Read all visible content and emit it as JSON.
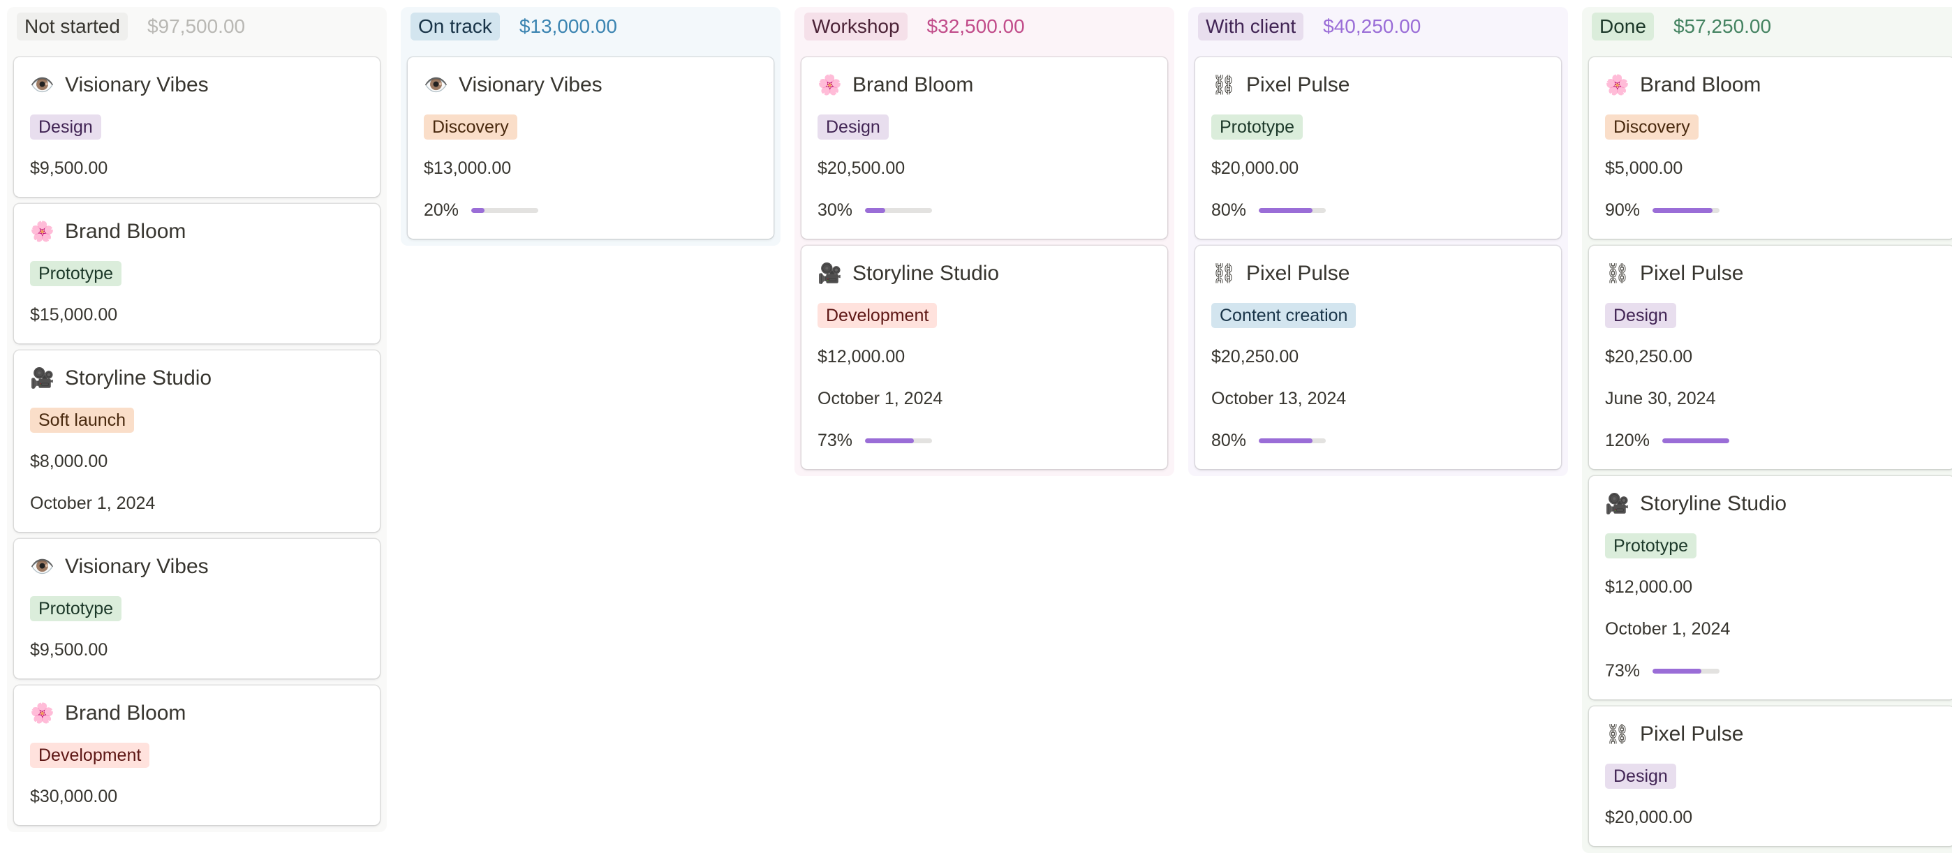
{
  "colors": {
    "accent_progress": "#9a6dd7",
    "tag_design": "#e8deee",
    "tag_prototype": "#dbeddb",
    "tag_discovery": "#fadec9",
    "tag_soft_launch": "#fadec9",
    "tag_development": "#ffe2dd",
    "tag_content_creation": "#d3e5ef"
  },
  "columns": [
    {
      "name": "Not started",
      "total": "$97,500.00",
      "bg": "#f9f9f8",
      "pill_bg": "#efefed",
      "pill_color": "#37352f",
      "total_color": "#b9b8b4",
      "cards": [
        {
          "icon": "eye-icon",
          "glyph": "👁️",
          "title": "Visionary Vibes",
          "tag": "Design",
          "tag_bg": "#e8deee",
          "tag_color": "#412454",
          "amount": "$9,500.00"
        },
        {
          "icon": "flower-icon",
          "glyph": "🌸",
          "title": "Brand Bloom",
          "tag": "Prototype",
          "tag_bg": "#dbeddb",
          "tag_color": "#1c3829",
          "amount": "$15,000.00"
        },
        {
          "icon": "film-camera-icon",
          "glyph": "🎥",
          "title": "Storyline Studio",
          "tag": "Soft launch",
          "tag_bg": "#fadec9",
          "tag_color": "#49290e",
          "amount": "$8,000.00",
          "date": "October 1, 2024"
        },
        {
          "icon": "eye-icon",
          "glyph": "👁️",
          "title": "Visionary Vibes",
          "tag": "Prototype",
          "tag_bg": "#dbeddb",
          "tag_color": "#1c3829",
          "amount": "$9,500.00"
        },
        {
          "icon": "flower-icon",
          "glyph": "🌸",
          "title": "Brand Bloom",
          "tag": "Development",
          "tag_bg": "#ffe2dd",
          "tag_color": "#5d1715",
          "amount": "$30,000.00"
        }
      ]
    },
    {
      "name": "On track",
      "total": "$13,000.00",
      "bg": "#f3f8fb",
      "pill_bg": "#d3e5ef",
      "pill_color": "#183347",
      "total_color": "#3b84b1",
      "cards": [
        {
          "icon": "eye-icon",
          "glyph": "👁️",
          "title": "Visionary Vibes",
          "tag": "Discovery",
          "tag_bg": "#fadec9",
          "tag_color": "#49290e",
          "amount": "$13,000.00",
          "progress_label": "20%",
          "progress": 0.2
        }
      ]
    },
    {
      "name": "Workshop",
      "total": "$32,500.00",
      "bg": "#fcf4f8",
      "pill_bg": "#f5e0e9",
      "pill_color": "#4c2337",
      "total_color": "#c14c8a",
      "cards": [
        {
          "icon": "flower-icon",
          "glyph": "🌸",
          "title": "Brand Bloom",
          "tag": "Design",
          "tag_bg": "#e8deee",
          "tag_color": "#412454",
          "amount": "$20,500.00",
          "progress_label": "30%",
          "progress": 0.3
        },
        {
          "icon": "film-camera-icon",
          "glyph": "🎥",
          "title": "Storyline Studio",
          "tag": "Development",
          "tag_bg": "#ffe2dd",
          "tag_color": "#5d1715",
          "amount": "$12,000.00",
          "date": "October 1, 2024",
          "progress_label": "73%",
          "progress": 0.73
        }
      ]
    },
    {
      "name": "With client",
      "total": "$40,250.00",
      "bg": "#f8f5fc",
      "pill_bg": "#e8deee",
      "pill_color": "#412454",
      "total_color": "#9a6dd7",
      "cards": [
        {
          "icon": "chain-link-icon",
          "glyph": "⛓",
          "title": "Pixel Pulse",
          "tag": "Prototype",
          "tag_bg": "#dbeddb",
          "tag_color": "#1c3829",
          "amount": "$20,000.00",
          "progress_label": "80%",
          "progress": 0.8
        },
        {
          "icon": "chain-link-icon",
          "glyph": "⛓",
          "title": "Pixel Pulse",
          "tag": "Content creation",
          "tag_bg": "#d3e5ef",
          "tag_color": "#183347",
          "amount": "$20,250.00",
          "date": "October 13, 2024",
          "progress_label": "80%",
          "progress": 0.8
        }
      ]
    },
    {
      "name": "Done",
      "total": "$57,250.00",
      "bg": "#f4f8f3",
      "pill_bg": "#dbeddb",
      "pill_color": "#1c3829",
      "total_color": "#448361",
      "cards": [
        {
          "icon": "flower-icon",
          "glyph": "🌸",
          "title": "Brand Bloom",
          "tag": "Discovery",
          "tag_bg": "#fadec9",
          "tag_color": "#49290e",
          "amount": "$5,000.00",
          "progress_label": "90%",
          "progress": 0.9
        },
        {
          "icon": "chain-link-icon",
          "glyph": "⛓",
          "title": "Pixel Pulse",
          "tag": "Design",
          "tag_bg": "#e8deee",
          "tag_color": "#412454",
          "amount": "$20,250.00",
          "date": "June 30, 2024",
          "progress_label": "120%",
          "progress": 1.2
        },
        {
          "icon": "film-camera-icon",
          "glyph": "🎥",
          "title": "Storyline Studio",
          "tag": "Prototype",
          "tag_bg": "#dbeddb",
          "tag_color": "#1c3829",
          "amount": "$12,000.00",
          "date": "October 1, 2024",
          "progress_label": "73%",
          "progress": 0.73
        },
        {
          "icon": "chain-link-icon",
          "glyph": "⛓",
          "title": "Pixel Pulse",
          "tag": "Design",
          "tag_bg": "#e8deee",
          "tag_color": "#412454",
          "amount": "$20,000.00"
        }
      ]
    }
  ]
}
